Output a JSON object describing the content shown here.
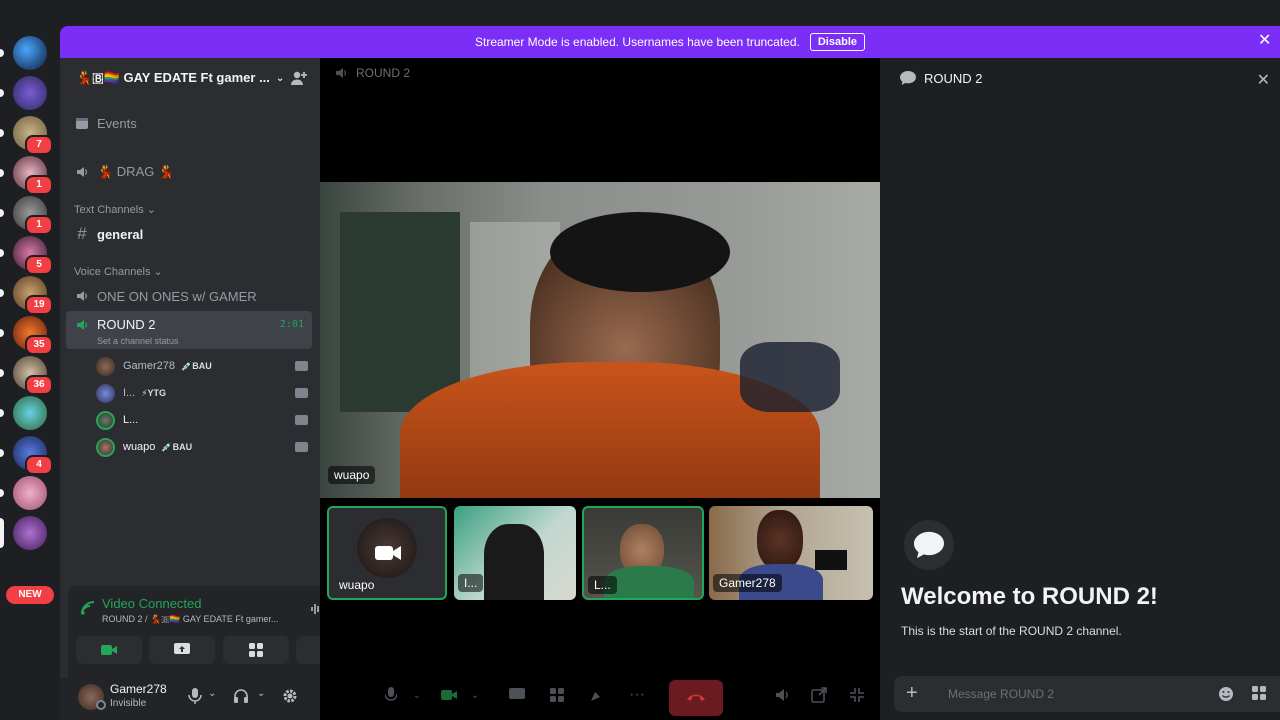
{
  "banner": {
    "text": "Streamer Mode is enabled. Usernames have been truncated.",
    "button": "Disable"
  },
  "rail": {
    "badges": [
      "7",
      "1",
      "1",
      "5",
      "19",
      "35",
      "36",
      "4"
    ],
    "new_label": "NEW"
  },
  "guild": {
    "name": "💃🇧🏳️‍🌈 GAY EDATE Ft gamer ..."
  },
  "sidebar": {
    "events": "Events",
    "drag_channel": "💃 DRAG 💃",
    "text_category": "Text Channels",
    "general": "general",
    "voice_category": "Voice Channels",
    "one_on_ones": "ONE ON ONES w/ GAMER",
    "round2": "ROUND 2",
    "round2_timer": "2:01",
    "round2_status": "Set a channel status",
    "members": [
      {
        "name": "Gamer278",
        "tag": "💉BAU"
      },
      {
        "name": "I...",
        "tag": "⚡YTG"
      },
      {
        "name": "L...",
        "tag": ""
      },
      {
        "name": "wuapo",
        "tag": "💉BAU"
      }
    ]
  },
  "voice": {
    "status": "Video Connected",
    "location": "ROUND 2 / 💃🇧🏳️‍🌈 GAY EDATE Ft gamer..."
  },
  "user": {
    "name": "Gamer278",
    "status": "Invisible"
  },
  "stage": {
    "title": "ROUND 2",
    "main_name": "wuapo",
    "tiles": [
      "wuapo",
      "I...",
      "L...",
      "Gamer278"
    ]
  },
  "chat": {
    "title": "ROUND 2",
    "welcome_title": "Welcome to ROUND 2!",
    "welcome_sub": "This is the start of the ROUND 2 channel.",
    "placeholder": "Message ROUND 2"
  },
  "colors": {
    "accent": "#7b2ef5",
    "green": "#23a55a",
    "red": "#f23f43"
  }
}
